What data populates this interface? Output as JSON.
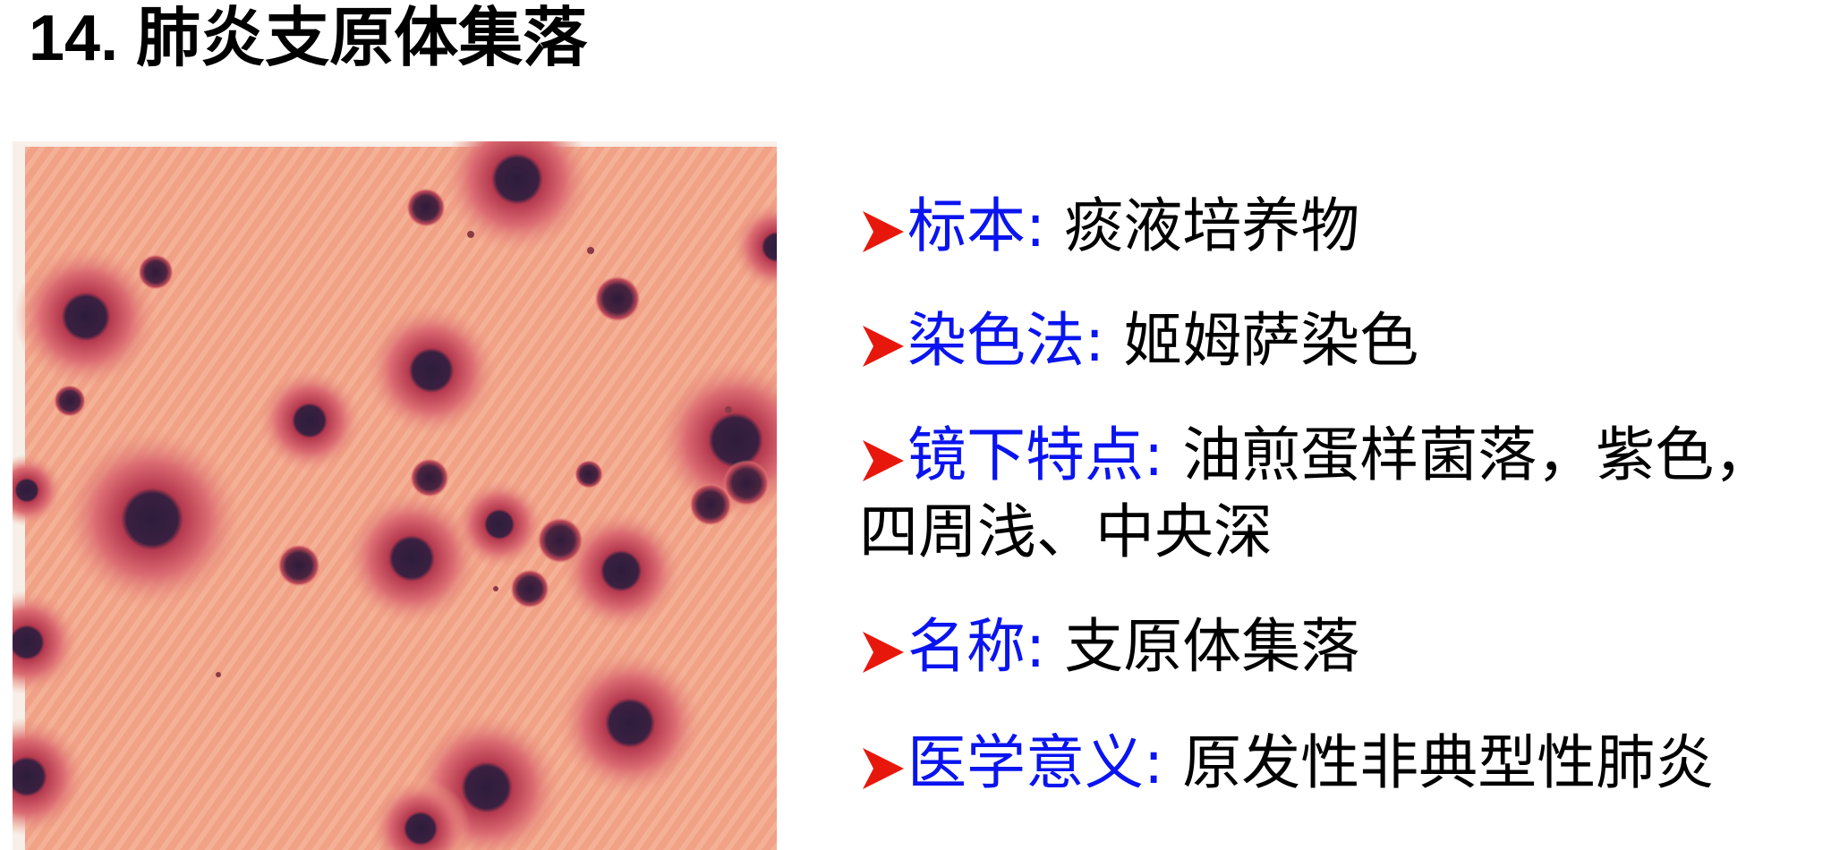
{
  "slide": {
    "title": "14. 肺炎支原体集落",
    "accent_arrow_color": "#e8170c",
    "label_color": "#0a14f0",
    "items": [
      {
        "label": "标本",
        "sep": ":",
        "value": "痰液培养物"
      },
      {
        "label": "染色法",
        "sep": ":",
        "value": "姬姆萨染色"
      },
      {
        "label": "镜下特点",
        "sep": ":",
        "value": "油煎蛋样菌落，紫色，",
        "value2": "四周浅、中央深"
      },
      {
        "label": "名称",
        "sep": ":",
        "value": "支原体集落"
      },
      {
        "label": "医学意义",
        "sep": ":",
        "value": "原发性非典型性肺炎"
      }
    ]
  }
}
